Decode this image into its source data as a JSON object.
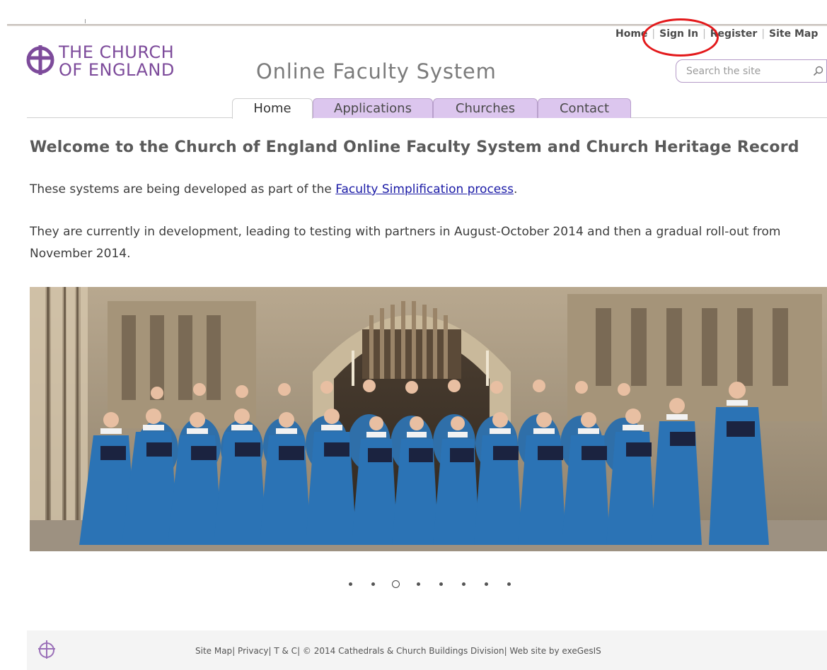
{
  "utility_nav": {
    "home": "Home",
    "sign_in": "Sign In",
    "register": "Register",
    "site_map": "Site Map",
    "separator": "|"
  },
  "brand": {
    "logo_line1": "THE CHURCH",
    "logo_line2": "OF ENGLAND",
    "site_title": "Online Faculty System",
    "brand_color": "#7d4b9b"
  },
  "search": {
    "placeholder": "Search the site",
    "icon": "search-icon"
  },
  "tabs": [
    {
      "label": "Home",
      "active": true
    },
    {
      "label": "Applications",
      "active": false
    },
    {
      "label": "Churches",
      "active": false
    },
    {
      "label": "Contact",
      "active": false
    }
  ],
  "main": {
    "heading": "Welcome to the Church of England Online Faculty System and Church Heritage Record",
    "intro_prefix": "These systems are being developed as part of the ",
    "intro_link": "Faculty Simplification process",
    "intro_suffix": ".",
    "status_text": "They are currently in development, leading to testing with partners in August-October 2014 and then a gradual roll-out from November 2014."
  },
  "carousel": {
    "slide_count": 8,
    "active_slide": 3
  },
  "footer": {
    "site_map": "Site Map",
    "privacy": "Privacy",
    "terms": "T & C",
    "copyright": "© 2014 Cathedrals & Church Buildings Division",
    "credit": "Web site by exeGesIS",
    "sep": "| "
  }
}
